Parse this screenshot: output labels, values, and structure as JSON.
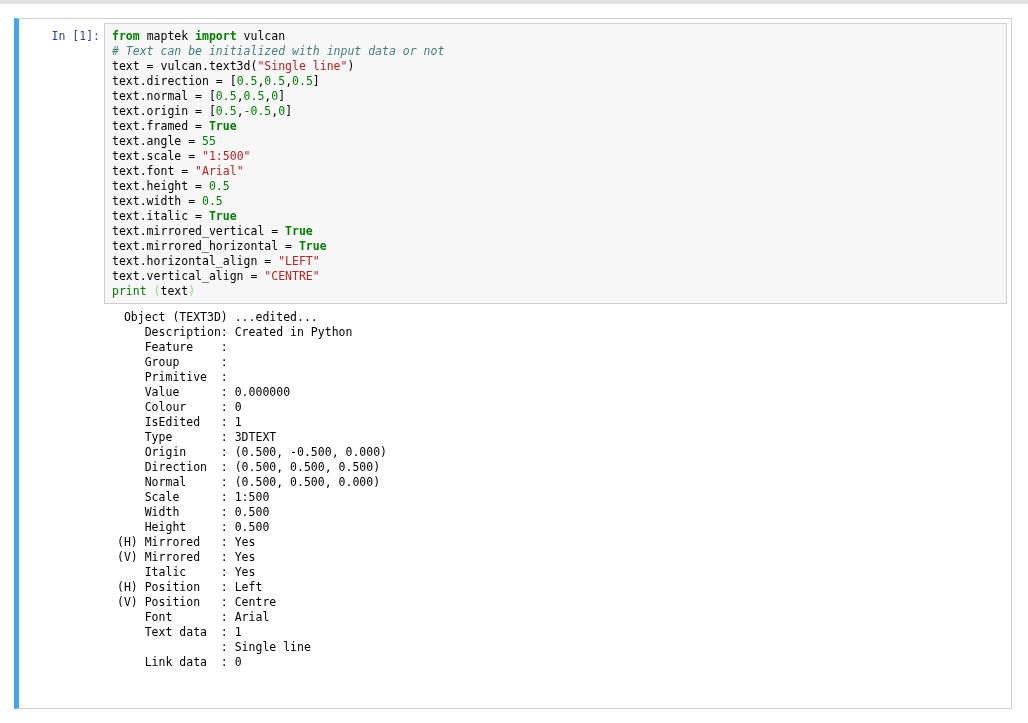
{
  "cell": {
    "prompt": "In [1]:",
    "selected": true,
    "code_lines": [
      [
        {
          "kind": "kw",
          "text": "from"
        },
        {
          "kind": "plain",
          "text": " maptek "
        },
        {
          "kind": "kw",
          "text": "import"
        },
        {
          "kind": "plain",
          "text": " vulcan"
        }
      ],
      [
        {
          "kind": "comment",
          "text": "# Text can be initialized with input data or not"
        }
      ],
      [
        {
          "kind": "plain",
          "text": "text = vulcan.text3d("
        },
        {
          "kind": "str",
          "text": "\"Single line\""
        },
        {
          "kind": "plain",
          "text": ")"
        }
      ],
      [
        {
          "kind": "plain",
          "text": "text.direction = ["
        },
        {
          "kind": "num",
          "text": "0.5"
        },
        {
          "kind": "plain",
          "text": ","
        },
        {
          "kind": "num",
          "text": "0.5"
        },
        {
          "kind": "plain",
          "text": ","
        },
        {
          "kind": "num",
          "text": "0.5"
        },
        {
          "kind": "plain",
          "text": "]"
        }
      ],
      [
        {
          "kind": "plain",
          "text": "text.normal = ["
        },
        {
          "kind": "num",
          "text": "0.5"
        },
        {
          "kind": "plain",
          "text": ","
        },
        {
          "kind": "num",
          "text": "0.5"
        },
        {
          "kind": "plain",
          "text": ","
        },
        {
          "kind": "num",
          "text": "0"
        },
        {
          "kind": "plain",
          "text": "]"
        }
      ],
      [
        {
          "kind": "plain",
          "text": "text.origin = ["
        },
        {
          "kind": "num",
          "text": "0.5"
        },
        {
          "kind": "plain",
          "text": ","
        },
        {
          "kind": "num",
          "text": "-0.5"
        },
        {
          "kind": "plain",
          "text": ","
        },
        {
          "kind": "num",
          "text": "0"
        },
        {
          "kind": "plain",
          "text": "]"
        }
      ],
      [
        {
          "kind": "plain",
          "text": "text.framed = "
        },
        {
          "kind": "kw",
          "text": "True"
        }
      ],
      [
        {
          "kind": "plain",
          "text": "text.angle = "
        },
        {
          "kind": "num",
          "text": "55"
        }
      ],
      [
        {
          "kind": "plain",
          "text": "text.scale = "
        },
        {
          "kind": "str",
          "text": "\"1:500\""
        }
      ],
      [
        {
          "kind": "plain",
          "text": "text.font = "
        },
        {
          "kind": "str",
          "text": "\"Arial\""
        }
      ],
      [
        {
          "kind": "plain",
          "text": "text.height = "
        },
        {
          "kind": "num",
          "text": "0.5"
        }
      ],
      [
        {
          "kind": "plain",
          "text": "text.width = "
        },
        {
          "kind": "num",
          "text": "0.5"
        }
      ],
      [
        {
          "kind": "plain",
          "text": "text.italic = "
        },
        {
          "kind": "kw",
          "text": "True"
        }
      ],
      [
        {
          "kind": "plain",
          "text": "text.mirrored_vertical = "
        },
        {
          "kind": "kw",
          "text": "True"
        }
      ],
      [
        {
          "kind": "plain",
          "text": "text.mirrored_horizontal = "
        },
        {
          "kind": "kw",
          "text": "True"
        }
      ],
      [
        {
          "kind": "plain",
          "text": "text.horizontal_align = "
        },
        {
          "kind": "str",
          "text": "\"LEFT\""
        }
      ],
      [
        {
          "kind": "plain",
          "text": "text.vertical_align = "
        },
        {
          "kind": "str",
          "text": "\"CENTRE\""
        }
      ],
      [
        {
          "kind": "builtin",
          "text": "print"
        },
        {
          "kind": "paren",
          "text": " ("
        },
        {
          "kind": "plain",
          "text": "text"
        },
        {
          "kind": "paren",
          "text": ")"
        }
      ]
    ],
    "output_lines": [
      " Object (TEXT3D) ...edited...",
      "    Description: Created in Python",
      "    Feature    :",
      "    Group      :",
      "    Primitive  :",
      "    Value      : 0.000000",
      "    Colour     : 0",
      "    IsEdited   : 1",
      "    Type       : 3DTEXT",
      "    Origin     : (0.500, -0.500, 0.000)",
      "    Direction  : (0.500, 0.500, 0.500)",
      "    Normal     : (0.500, 0.500, 0.000)",
      "    Scale      : 1:500",
      "    Width      : 0.500",
      "    Height     : 0.500",
      "(H) Mirrored   : Yes",
      "(V) Mirrored   : Yes",
      "    Italic     : Yes",
      "(H) Position   : Left",
      "(V) Position   : Centre",
      "    Font       : Arial",
      "    Text data  : 1",
      "               : Single line",
      "    Link data  : 0"
    ]
  }
}
